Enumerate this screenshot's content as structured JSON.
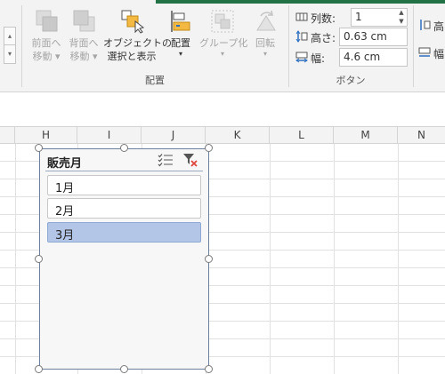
{
  "ribbon": {
    "bring_forward": {
      "label": "前面へ",
      "label2": "移動"
    },
    "send_backward": {
      "label": "背面へ",
      "label2": "移動"
    },
    "selection_pane": {
      "label": "オブジェクトの",
      "label2": "選択と表示"
    },
    "align": {
      "label": "配置"
    },
    "group": {
      "label": "グループ化"
    },
    "rotate": {
      "label": "回転"
    },
    "arrange_group_label": "配置",
    "columns": {
      "label": "列数:",
      "value": "1"
    },
    "height": {
      "label": "高さ:",
      "value": "0.63 cm"
    },
    "width": {
      "label": "幅:",
      "value": "4.6 cm"
    },
    "buttons_group_label": "ボタン",
    "edge_height": {
      "label": "高"
    },
    "edge_width": {
      "label": "幅"
    }
  },
  "columns": [
    "H",
    "I",
    "J",
    "K",
    "L",
    "M",
    "N"
  ],
  "slicer": {
    "title": "販売月",
    "items": [
      {
        "label": "1月",
        "selected": false
      },
      {
        "label": "2月",
        "selected": false
      },
      {
        "label": "3月",
        "selected": true
      }
    ]
  },
  "colors": {
    "accent": "#217346",
    "selected_item": "#b4c6e7",
    "slicer_border": "#6c7f9c"
  },
  "icons": [
    "multi-select-icon",
    "clear-filter-icon"
  ]
}
